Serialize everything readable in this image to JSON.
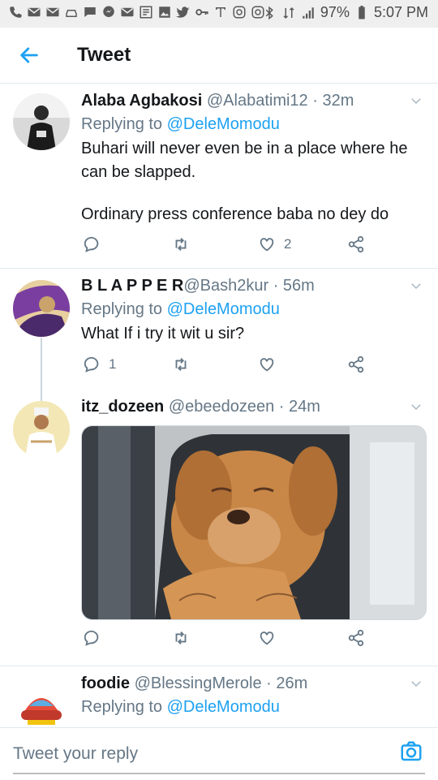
{
  "status_bar": {
    "battery_percent": "97%",
    "time": "5:07 PM"
  },
  "header": {
    "title": "Tweet"
  },
  "tweets": [
    {
      "name": "Alaba Agbakosi",
      "handle": "@Alabatimi12",
      "time": "· 32m",
      "replying_label": "Replying to",
      "replying_to": "@DeleMomodu",
      "text_lines": [
        "Buhari will never even be in a place where he",
        "can be slapped."
      ],
      "text_second": "Ordinary press conference baba no dey do",
      "like_count": "2"
    },
    {
      "name": "B L A P P E R",
      "handle": "@Bash2kur",
      "time": "· 56m",
      "replying_label": "Replying to",
      "replying_to": "@DeleMomodu",
      "text": "What If i try it wit u sir?",
      "reply_count": "1"
    },
    {
      "name": "itz_dozeen",
      "handle": "@ebeedozeen",
      "time": "· 24m"
    },
    {
      "name": "foodie",
      "handle": "@BlessingMerole",
      "time": "· 26m",
      "replying_label": "Replying to",
      "replying_to": "@DeleMomodu"
    }
  ],
  "composer": {
    "placeholder": "Tweet your reply"
  },
  "colors": {
    "accent": "#1da1f2",
    "secondary_text": "#657786"
  }
}
